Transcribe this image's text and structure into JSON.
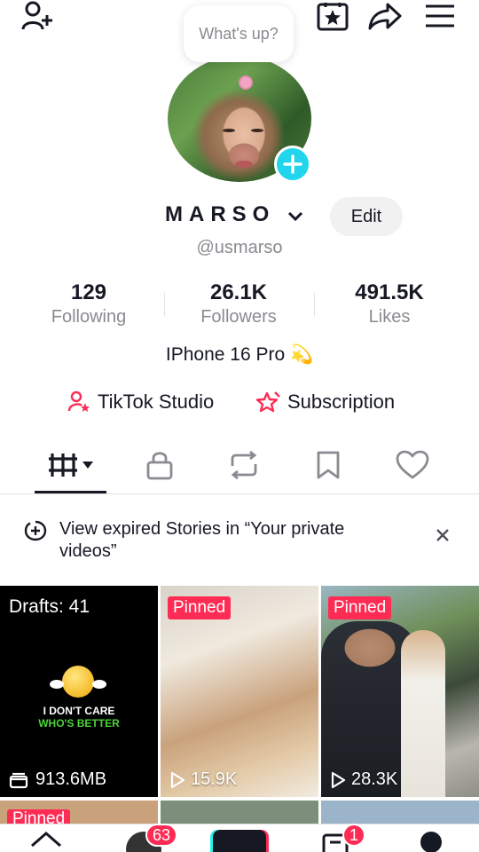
{
  "bubble": {
    "text": "What's up?"
  },
  "profile": {
    "name": "MARSO",
    "edit_label": "Edit",
    "handle": "@usmarso",
    "bio": "IPhone  16 Pro 💫"
  },
  "stats": [
    {
      "value": "129",
      "label": "Following"
    },
    {
      "value": "26.1K",
      "label": "Followers"
    },
    {
      "value": "491.5K",
      "label": "Likes"
    }
  ],
  "links": {
    "studio": "TikTok Studio",
    "subscription": "Subscription"
  },
  "tabs": [
    {
      "icon": "videos-grid-icon",
      "active": true
    },
    {
      "icon": "lock-icon"
    },
    {
      "icon": "repost-icon"
    },
    {
      "icon": "bookmark-icon"
    },
    {
      "icon": "heart-icon"
    }
  ],
  "stories_notice": {
    "text": "View expired Stories in “Your private videos”"
  },
  "grid": {
    "drafts": {
      "label": "Drafts: 41",
      "size": "913.6MB",
      "caption_line1": "I DON'T CARE",
      "caption_line2": "WHO'S BETTER"
    },
    "tiles": [
      {
        "badge": "Pinned",
        "views": "15.9K"
      },
      {
        "badge": "Pinned",
        "views": "28.3K"
      }
    ],
    "peek_badge": "Pinned"
  },
  "nav": {
    "friends_badge": "63",
    "inbox_badge": "1"
  },
  "colors": {
    "accent": "#fe2c55",
    "cyan": "#20d5ec",
    "text": "#161823",
    "muted": "#8a8b91"
  }
}
